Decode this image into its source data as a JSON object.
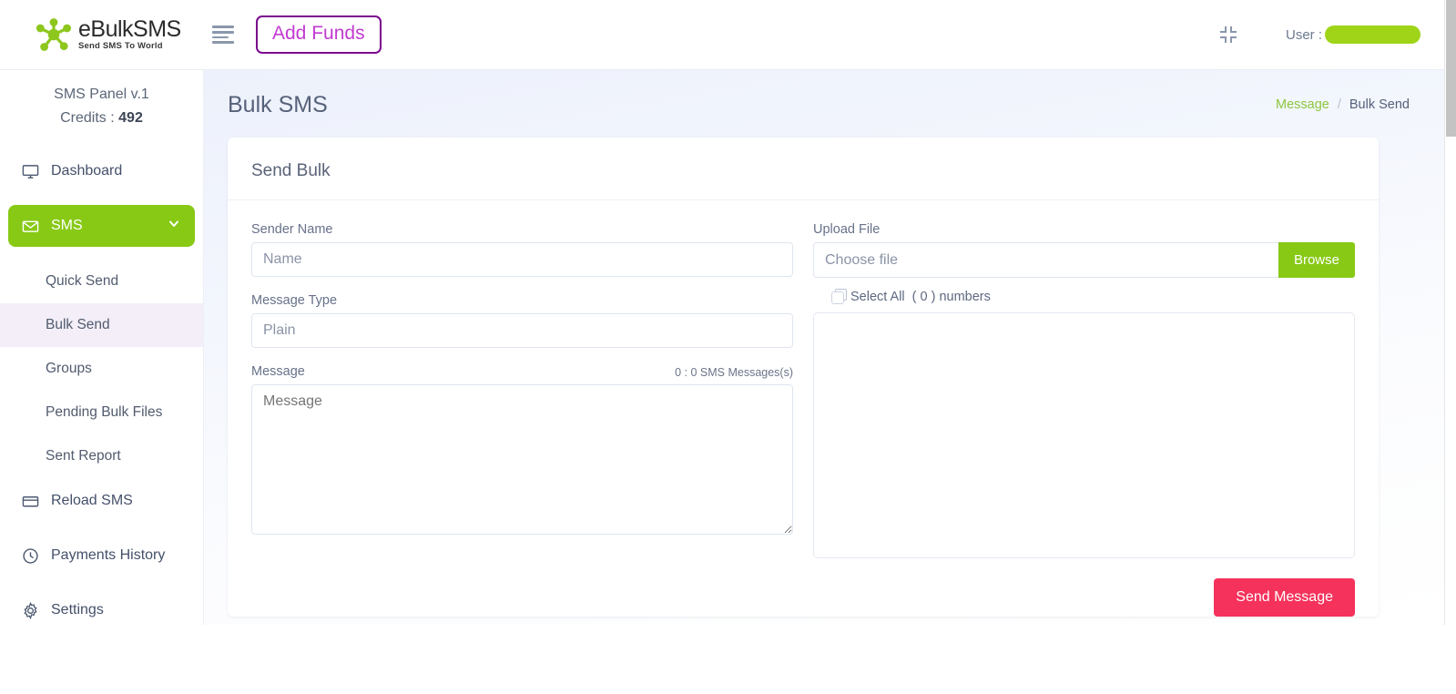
{
  "topbar": {
    "logo_title": "eBulkSMS",
    "logo_subtitle": "Send SMS To World",
    "menu_icon": "hamburger-icon",
    "add_funds_label": "Add Funds",
    "compress_icon": "compress-arrows-icon",
    "user_label": "User :",
    "user_value_redacted": ""
  },
  "sidebar": {
    "panel_title": "SMS Panel v.1",
    "credits_label": "Credits :",
    "credits_value": "492",
    "items": [
      {
        "label": "Dashboard",
        "icon": "monitor-icon"
      },
      {
        "label": "SMS",
        "icon": "envelope-icon",
        "chevron": "chevron-down-icon"
      },
      {
        "label": "Reload SMS",
        "icon": "credit-card-icon"
      },
      {
        "label": "Payments History",
        "icon": "clock-icon"
      },
      {
        "label": "Settings",
        "icon": "gear-icon"
      }
    ],
    "sub_items": [
      {
        "label": "Quick Send"
      },
      {
        "label": "Bulk Send"
      },
      {
        "label": "Groups"
      },
      {
        "label": "Pending Bulk Files"
      },
      {
        "label": "Sent Report"
      }
    ]
  },
  "page": {
    "title": "Bulk SMS",
    "breadcrumb_link": "Message",
    "breadcrumb_sep": "/",
    "breadcrumb_current": "Bulk Send"
  },
  "card": {
    "heading": "Send Bulk",
    "left": {
      "sender_name_label": "Sender Name",
      "sender_name_placeholder": "Name",
      "sender_name_value": "",
      "message_type_label": "Message Type",
      "message_type_value": "Plain",
      "message_label": "Message",
      "message_counter": "0 : 0 SMS Messages(s)",
      "message_placeholder": "Message",
      "message_value": ""
    },
    "right": {
      "upload_file_label": "Upload File",
      "choose_file_placeholder": "Choose file",
      "choose_file_value": "",
      "browse_label": "Browse",
      "select_all_label": "Select All",
      "select_all_count": "( 0 ) numbers",
      "numbers_value": "",
      "send_button_label": "Send Message"
    }
  },
  "colors": {
    "brand_green": "#88c916",
    "accent_purple": "#c23ad1",
    "accent_purple_border": "#7b0a8f",
    "send_red": "#f5325b",
    "breadcrumb_link": "#8cc63e",
    "sidebar_selected_bg": "#f3eef8",
    "text_slate": "#44506a"
  }
}
